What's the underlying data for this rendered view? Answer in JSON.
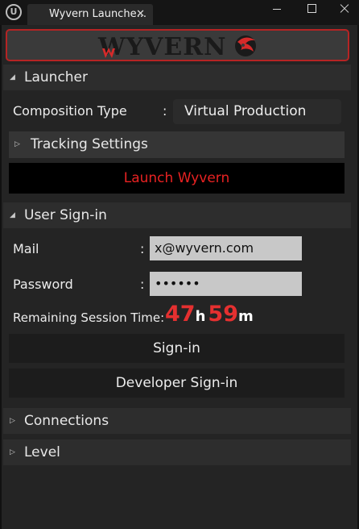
{
  "window": {
    "tab_title": "Wyvern Launche...",
    "tab_close": "✕"
  },
  "banner": {
    "logo_text": "WYVERN",
    "accent_color": "#d62a2a"
  },
  "launcher": {
    "header": "Launcher",
    "composition_label": "Composition Type",
    "composition_value": "Virtual Production",
    "tracking_settings": "Tracking Settings",
    "launch_button": "Launch Wyvern"
  },
  "signin": {
    "header": "User Sign-in",
    "mail_label": "Mail",
    "mail_value": "x@wyvern.com",
    "password_label": "Password",
    "password_value": "••••••",
    "remaining_label": "Remaining Session Time:",
    "hours": "47",
    "hours_unit": "h",
    "minutes": "59",
    "minutes_unit": "m",
    "signin_button": "Sign-in",
    "dev_signin_button": "Developer Sign-in"
  },
  "connections": {
    "header": "Connections"
  },
  "level": {
    "header": "Level"
  },
  "colon": ":",
  "arrows": {
    "expanded": "◢",
    "collapsed": "▷"
  }
}
